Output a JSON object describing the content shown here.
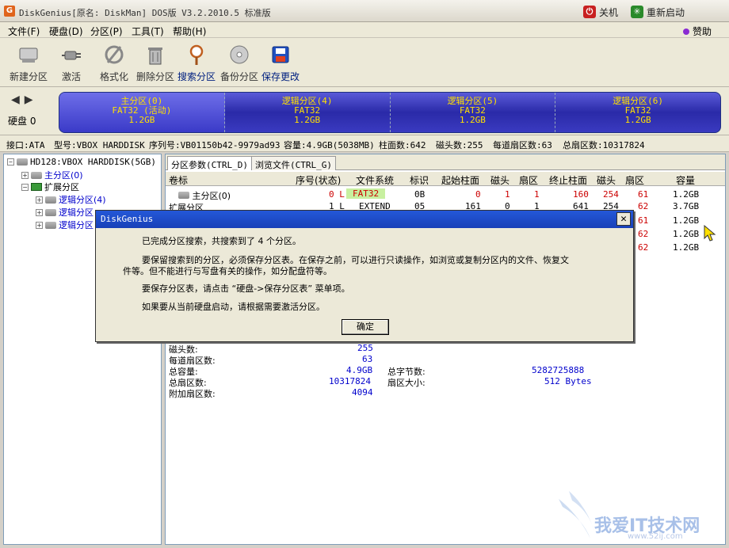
{
  "window": {
    "title": "DiskGenius[原名: DiskMan] DOS版 V3.2.2010.5 标准版",
    "shutdown": "关机",
    "restart": "重新启动"
  },
  "menu": [
    "文件(F)",
    "硬盘(D)",
    "分区(P)",
    "工具(T)",
    "帮助(H)"
  ],
  "donate": "赞助",
  "toolbar": [
    "新建分区",
    "激活",
    "格式化",
    "删除分区",
    "搜索分区",
    "备份分区",
    "保存更改"
  ],
  "disk": {
    "label": "硬盘 0",
    "partitions": [
      {
        "name": "主分区(0)",
        "fs": "FAT32 (活动)",
        "size": "1.2GB"
      },
      {
        "name": "逻辑分区(4)",
        "fs": "FAT32",
        "size": "1.2GB"
      },
      {
        "name": "逻辑分区(5)",
        "fs": "FAT32",
        "size": "1.2GB"
      },
      {
        "name": "逻辑分区(6)",
        "fs": "FAT32",
        "size": "1.2GB"
      }
    ]
  },
  "info": {
    "iface": "接口:ATA",
    "model": "型号:VBOX HARDDISK",
    "serial": "序列号:VB01150b42-9979ad93",
    "capacity": "容量:4.9GB(5038MB)",
    "cyl": "柱面数:642",
    "heads": "磁头数:255",
    "spt": "每道扇区数:63",
    "total": "总扇区数:10317824"
  },
  "tree": {
    "disk": "HD128:VBOX HARDDISK(5GB)",
    "primary": "主分区(0)",
    "extended": "扩展分区",
    "logical4": "逻辑分区(4)",
    "logical5": "逻辑分区",
    "logical6": "逻辑分区"
  },
  "tabs": [
    "分区参数(CTRL_D)",
    "浏览文件(CTRL_G)"
  ],
  "columns": [
    "卷标",
    "序号(状态)",
    "文件系统",
    "标识",
    "起始柱面",
    "磁头",
    "扇区",
    "终止柱面",
    "磁头",
    "扇区",
    "容量"
  ],
  "rows": [
    {
      "label": "主分区(0)",
      "seq": "0 L",
      "fs": "FAT32",
      "id": "0B",
      "sc": "0",
      "sh": "1",
      "ss": "1",
      "ec": "160",
      "eh": "254",
      "es": "61",
      "cap": "1.2GB"
    },
    {
      "label": "扩展分区",
      "seq": "1 L",
      "fs": "EXTEND",
      "id": "05",
      "sc": "161",
      "sh": "0",
      "ss": "1",
      "ec": "641",
      "eh": "254",
      "es": "62",
      "cap": "3.7GB"
    }
  ],
  "caps_hidden": [
    {
      "es": "61",
      "cap": "1.2GB"
    },
    {
      "es": "62",
      "cap": "1.2GB"
    },
    {
      "es": "62",
      "cap": "1.2GB"
    }
  ],
  "stats": {
    "heads_l": "磁头数:",
    "heads_v": "255",
    "spt_l": "每道扇区数:",
    "spt_v": "63",
    "cap_l": "总容量:",
    "cap_v": "4.9GB",
    "total_l": "总扇区数:",
    "total_v": "10317824",
    "extra_l": "附加扇区数:",
    "extra_v": "4094",
    "bytes_l": "总字节数:",
    "bytes_v": "5282725888",
    "ssize_l": "扇区大小:",
    "ssize_v": "512 Bytes"
  },
  "dialog": {
    "title": "DiskGenius",
    "line1": "已完成分区搜索，共搜索到了 4 个分区。",
    "line2": "要保留搜索到的分区，必须保存分区表。在保存之前，可以进行只读操作，如浏览或复制分区内的文件、恢复文",
    "line3": "件等。但不能进行与写盘有关的操作，如分配盘符等。",
    "line4": "要保存分区表，请点击 “硬盘->保存分区表” 菜单项。",
    "line5": "如果要从当前硬盘启动，请根据需要激活分区。",
    "ok": "确定"
  },
  "watermark": {
    "name": "我爱IT技术网",
    "url": "www.52ij.com"
  },
  "colors": {
    "partition_bar": "#2a2aa8",
    "partition_text": "#ffe000",
    "dialog_title": "#1840b8"
  }
}
